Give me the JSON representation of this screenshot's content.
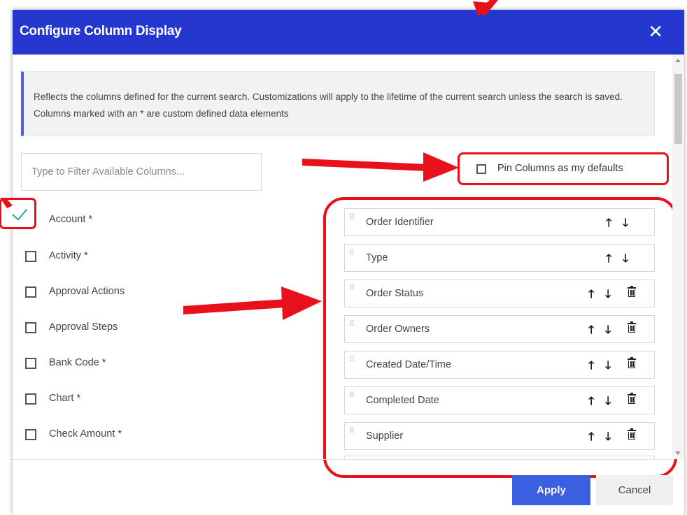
{
  "dialog": {
    "title": "Configure Column Display",
    "close_glyph": "✕",
    "info_text": "Reflects the columns defined for the current search. Customizations will apply to the lifetime of the current search unless the search is saved. Columns marked with an * are custom defined data elements"
  },
  "filter": {
    "placeholder": "Type to Filter Available Columns..."
  },
  "pin_defaults": {
    "label": "Pin Columns as my defaults",
    "checked": false
  },
  "available_columns": [
    {
      "label": "Account *",
      "checked": true
    },
    {
      "label": "Activity *",
      "checked": false
    },
    {
      "label": "Approval Actions",
      "checked": false
    },
    {
      "label": "Approval Steps",
      "checked": false
    },
    {
      "label": "Bank Code *",
      "checked": false
    },
    {
      "label": "Chart *",
      "checked": false
    },
    {
      "label": "Check Amount *",
      "checked": false
    }
  ],
  "selected_columns": [
    {
      "label": "Order Identifier",
      "removable": false
    },
    {
      "label": "Type",
      "removable": false
    },
    {
      "label": "Order Status",
      "removable": true
    },
    {
      "label": "Order Owners",
      "removable": true
    },
    {
      "label": "Created Date/Time",
      "removable": true
    },
    {
      "label": "Completed Date",
      "removable": true
    },
    {
      "label": "Supplier",
      "removable": true
    }
  ],
  "icons": {
    "up": "up-arrow-icon",
    "down": "down-arrow-icon",
    "remove": "trash-icon",
    "drag": "drag-handle-icon",
    "check": "checkmark-icon"
  },
  "glyphs": {
    "up": "🡑",
    "down": "🡓",
    "grip": "⠿"
  },
  "footer": {
    "apply_label": "Apply",
    "cancel_label": "Cancel"
  },
  "colors": {
    "header": "#2537cf",
    "apply": "#3a5fe0",
    "annotation": "#e8101a",
    "check": "#26a69a",
    "info_bar": "#4f63d8"
  }
}
